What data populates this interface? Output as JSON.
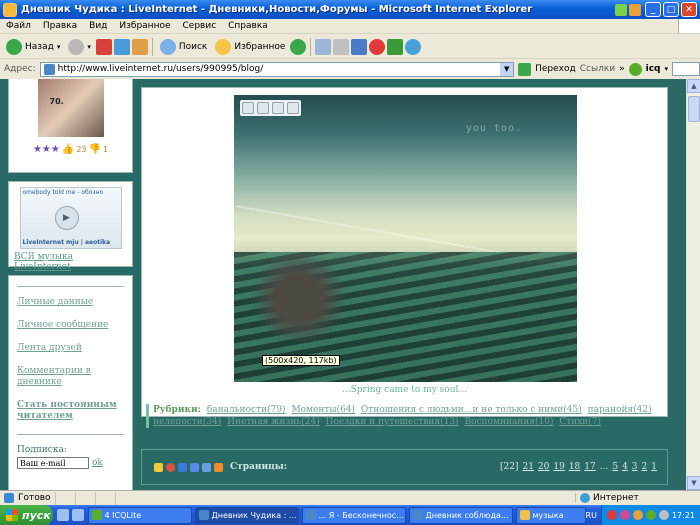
{
  "window": {
    "title": "Дневник Чудика : LiveInternet - Дневники,Новости,Форумы - Microsoft Internet Explorer"
  },
  "menu": [
    "Файл",
    "Правка",
    "Вид",
    "Избранное",
    "Сервис",
    "Справка"
  ],
  "toolbar": {
    "back": "Назад",
    "search": "Поиск",
    "favorites": "Избранное"
  },
  "address": {
    "label": "Адрес:",
    "url": "http://www.liveinternet.ru/users/990995/blog/",
    "go": "Переход",
    "links": "Ссылки",
    "icq": "icq"
  },
  "sidebar": {
    "avatar_number": "70.",
    "stars": "★★★",
    "likes": "23",
    "dislikes": "1",
    "player_track": "omebody told me - обозно",
    "player_brand": "LiveInternet  mju | aeotika",
    "music_link": "ВСЯ музыка LiveInternet",
    "menu": [
      "Личные данные",
      "Личное сообщение",
      "Лента друзей",
      "Комментарии в дневнике"
    ],
    "subscribe_permanent": "Стать постоянным читателем",
    "subscription_label": "Подписка:",
    "email_placeholder": "Ваш e-mail",
    "ok": "ok"
  },
  "post": {
    "watermark": "you too.",
    "image_size": "(500x420, 117kb)",
    "caption": "...Spring came to my soul...",
    "tags_label": "Рубрики:",
    "tags": [
      "банальности(79)",
      "Моменты(64)",
      "Отношения с людьми...и не только с ними(45)",
      "паранойя(42)",
      "нелепости(34)",
      "Инетная жизнь(24)",
      "Поездки и путешествия(13)",
      "Воспоминания(10)",
      "Стихи(7)"
    ]
  },
  "pager": {
    "label": "Страницы:",
    "current": "[22]",
    "pages": [
      "21",
      "20",
      "19",
      "18",
      "17",
      "...",
      "5",
      "4",
      "3",
      "2",
      "1"
    ]
  },
  "status": {
    "text": "Готово",
    "zone": "Интернет"
  },
  "taskbar": {
    "start": "пуск",
    "tasks": [
      "4 ICQLite",
      "Дневник Чудика : ...",
      "... Я - Бесконечнос...",
      "Дневник соблюда...",
      "музыка"
    ],
    "lang": "RU",
    "clock": "17:21"
  }
}
